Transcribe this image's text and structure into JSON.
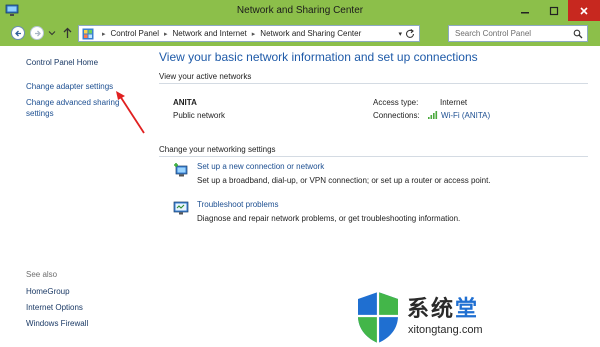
{
  "window": {
    "title": "Network and Sharing Center",
    "icon": "network-center-icon"
  },
  "address": {
    "breadcrumbs": [
      "Control Panel",
      "Network and Internet",
      "Network and Sharing Center"
    ],
    "search_placeholder": "Search Control Panel"
  },
  "sidebar": {
    "home": "Control Panel Home",
    "links": [
      "Change adapter settings",
      "Change advanced sharing settings"
    ],
    "see_also_label": "See also",
    "see_also": [
      "HomeGroup",
      "Internet Options",
      "Windows Firewall"
    ]
  },
  "main": {
    "heading": "View your basic network information and set up connections",
    "active_label": "View your active networks",
    "network": {
      "name": "ANITA",
      "type": "Public network",
      "access_label": "Access type:",
      "access_value": "Internet",
      "connections_label": "Connections:",
      "connection_link": "Wi-Fi (ANITA)"
    },
    "change_label": "Change your networking settings",
    "tasks": [
      {
        "link": "Set up a new connection or network",
        "desc": "Set up a broadband, dial-up, or VPN connection; or set up a router or access point."
      },
      {
        "link": "Troubleshoot problems",
        "desc": "Diagnose and repair network problems, or get troubleshooting information."
      }
    ]
  },
  "watermark": {
    "text_main": "系统",
    "text_accent": "堂",
    "url": "xitongtang.com"
  },
  "colors": {
    "titlebar": "#8cbf4a",
    "close": "#c7281f",
    "link": "#1d4f91",
    "heading": "#1e5aa8",
    "annotation_arrow": "#e02020"
  }
}
